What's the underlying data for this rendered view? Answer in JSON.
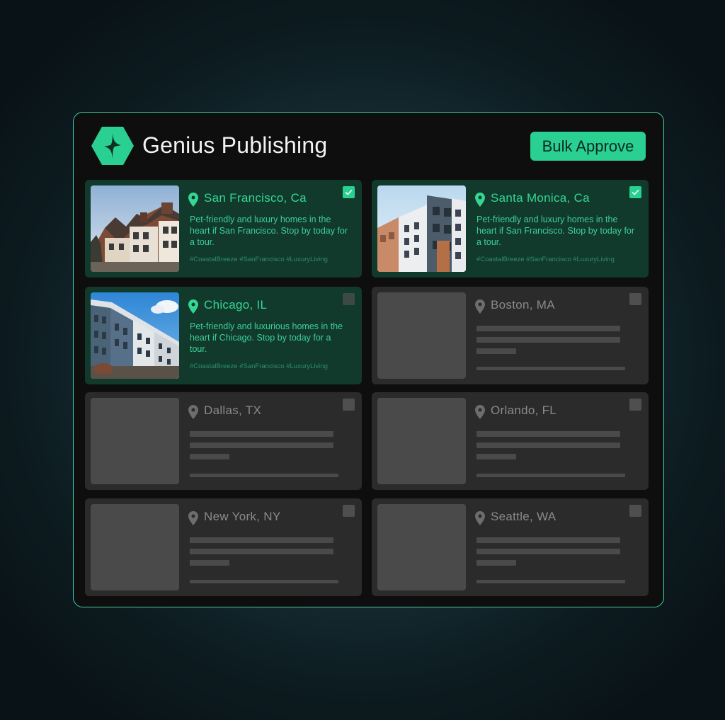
{
  "app": {
    "title": "Genius Publishing",
    "bulk_approve_label": "Bulk Approve"
  },
  "colors": {
    "accent": "#2ad091",
    "panel_border": "#3fcfa8",
    "card_active": "#113a2c",
    "card_empty": "#2b2b2b"
  },
  "listings": [
    {
      "city": "San Francisco, Ca",
      "description": "Pet-friendly and luxury homes in the heart if San Francisco. Stop by today for a tour.",
      "tags": "#CoastalBreeze #SanFrancisco #LuxuryLiving",
      "checked": true
    },
    {
      "city": "Santa Monica, Ca",
      "description": "Pet-friendly and luxury homes in the heart if San Francisco. Stop by today for a tour.",
      "tags": "#CoastalBreeze #SanFrancisco #LuxuryLiving",
      "checked": true
    },
    {
      "city": "Chicago, IL",
      "description": "Pet-friendly and luxurious homes in the heart if Chicago. Stop by today for a tour.",
      "tags": "#CoastalBreeze #SanFrancisco #LuxuryLiving",
      "checked": false
    },
    {
      "city": "Boston, MA",
      "checked": false
    },
    {
      "city": "Dallas, TX",
      "checked": false
    },
    {
      "city": "Orlando, FL",
      "checked": false
    },
    {
      "city": "New York, NY",
      "checked": false
    },
    {
      "city": "Seattle, WA",
      "checked": false
    }
  ]
}
